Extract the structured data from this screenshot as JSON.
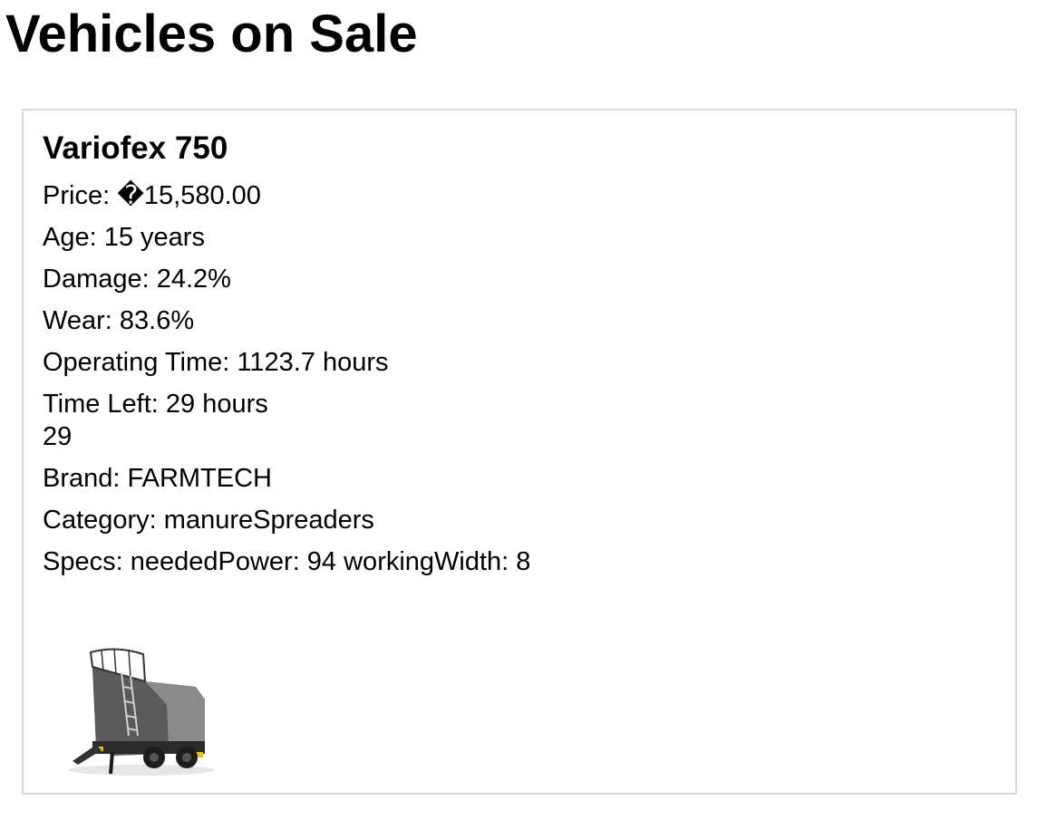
{
  "page": {
    "title": "Vehicles on Sale"
  },
  "vehicle": {
    "name": "Variofex 750",
    "price_label": "Price: ",
    "price_value": "�15,580.00",
    "age_label": "Age: ",
    "age_value": "15 years",
    "damage_label": "Damage: ",
    "damage_value": "24.2%",
    "wear_label": "Wear: ",
    "wear_value": "83.6%",
    "operating_label": "Operating Time: ",
    "operating_value": "1123.7 hours",
    "time_left_label": "Time Left: ",
    "time_left_value": "29 hours",
    "time_left_count": "29",
    "brand_label": "Brand: ",
    "brand_value": "FARMTECH",
    "category_label": "Category: ",
    "category_value": "manureSpreaders",
    "specs_label": "Specs: ",
    "specs_value": "neededPower: 94 workingWidth: 8",
    "image_icon": "manure-spreader-image"
  }
}
